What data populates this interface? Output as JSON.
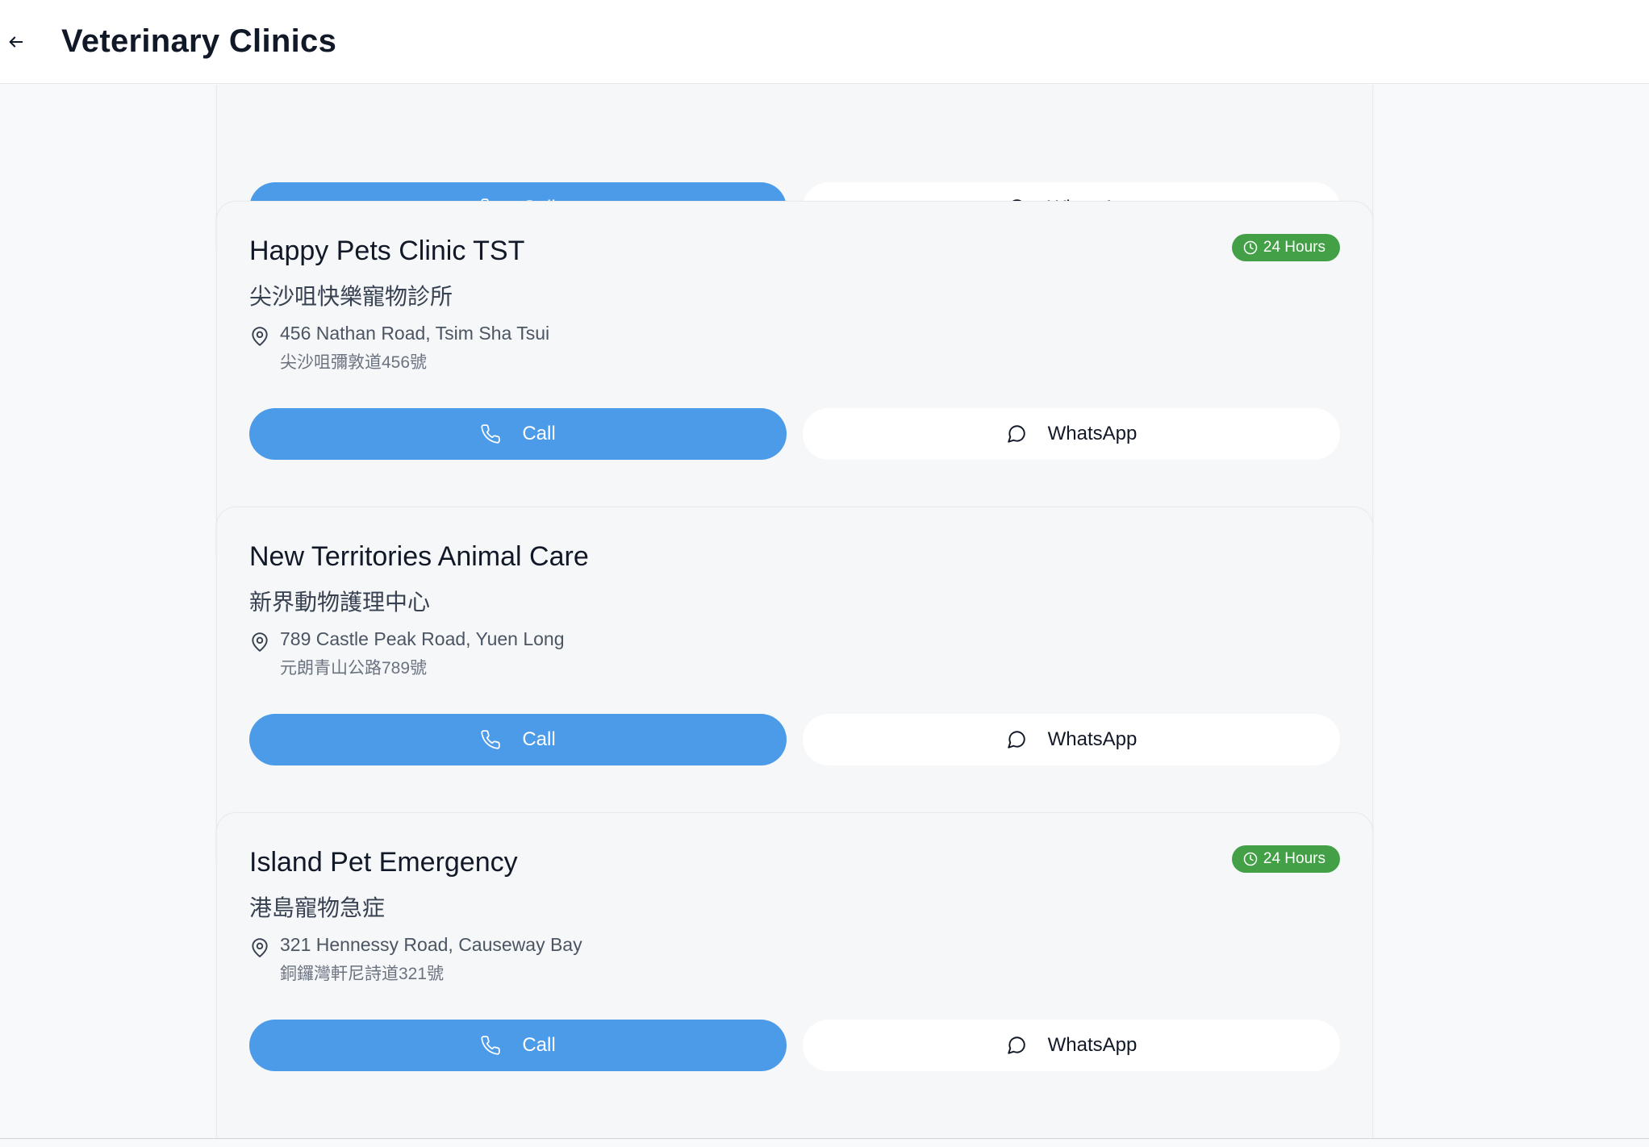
{
  "header": {
    "title": "Veterinary Clinics"
  },
  "actions": {
    "call_label": "Call",
    "whatsapp_label": "WhatsApp"
  },
  "colors": {
    "call_button": "#4c9be8",
    "badge_green": "#43a047"
  },
  "clinics": [
    {
      "name_en": "Happy Pets Clinic TST",
      "name_zh": "尖沙咀快樂寵物診所",
      "address_en": "456 Nathan Road, Tsim Sha Tsui",
      "address_zh": "尖沙咀彌敦道456號",
      "badge": "24 Hours"
    },
    {
      "name_en": "New Territories Animal Care",
      "name_zh": "新界動物護理中心",
      "address_en": "789 Castle Peak Road, Yuen Long",
      "address_zh": "元朗青山公路789號"
    },
    {
      "name_en": "Island Pet Emergency",
      "name_zh": "港島寵物急症",
      "address_en": "321 Hennessy Road, Causeway Bay",
      "address_zh": "銅鑼灣軒尼詩道321號",
      "badge": "24 Hours"
    }
  ],
  "icons": {
    "back": "arrow-left-icon",
    "phone": "phone-icon",
    "chat": "message-circle-icon",
    "location": "map-pin-icon",
    "clock": "clock-icon"
  }
}
